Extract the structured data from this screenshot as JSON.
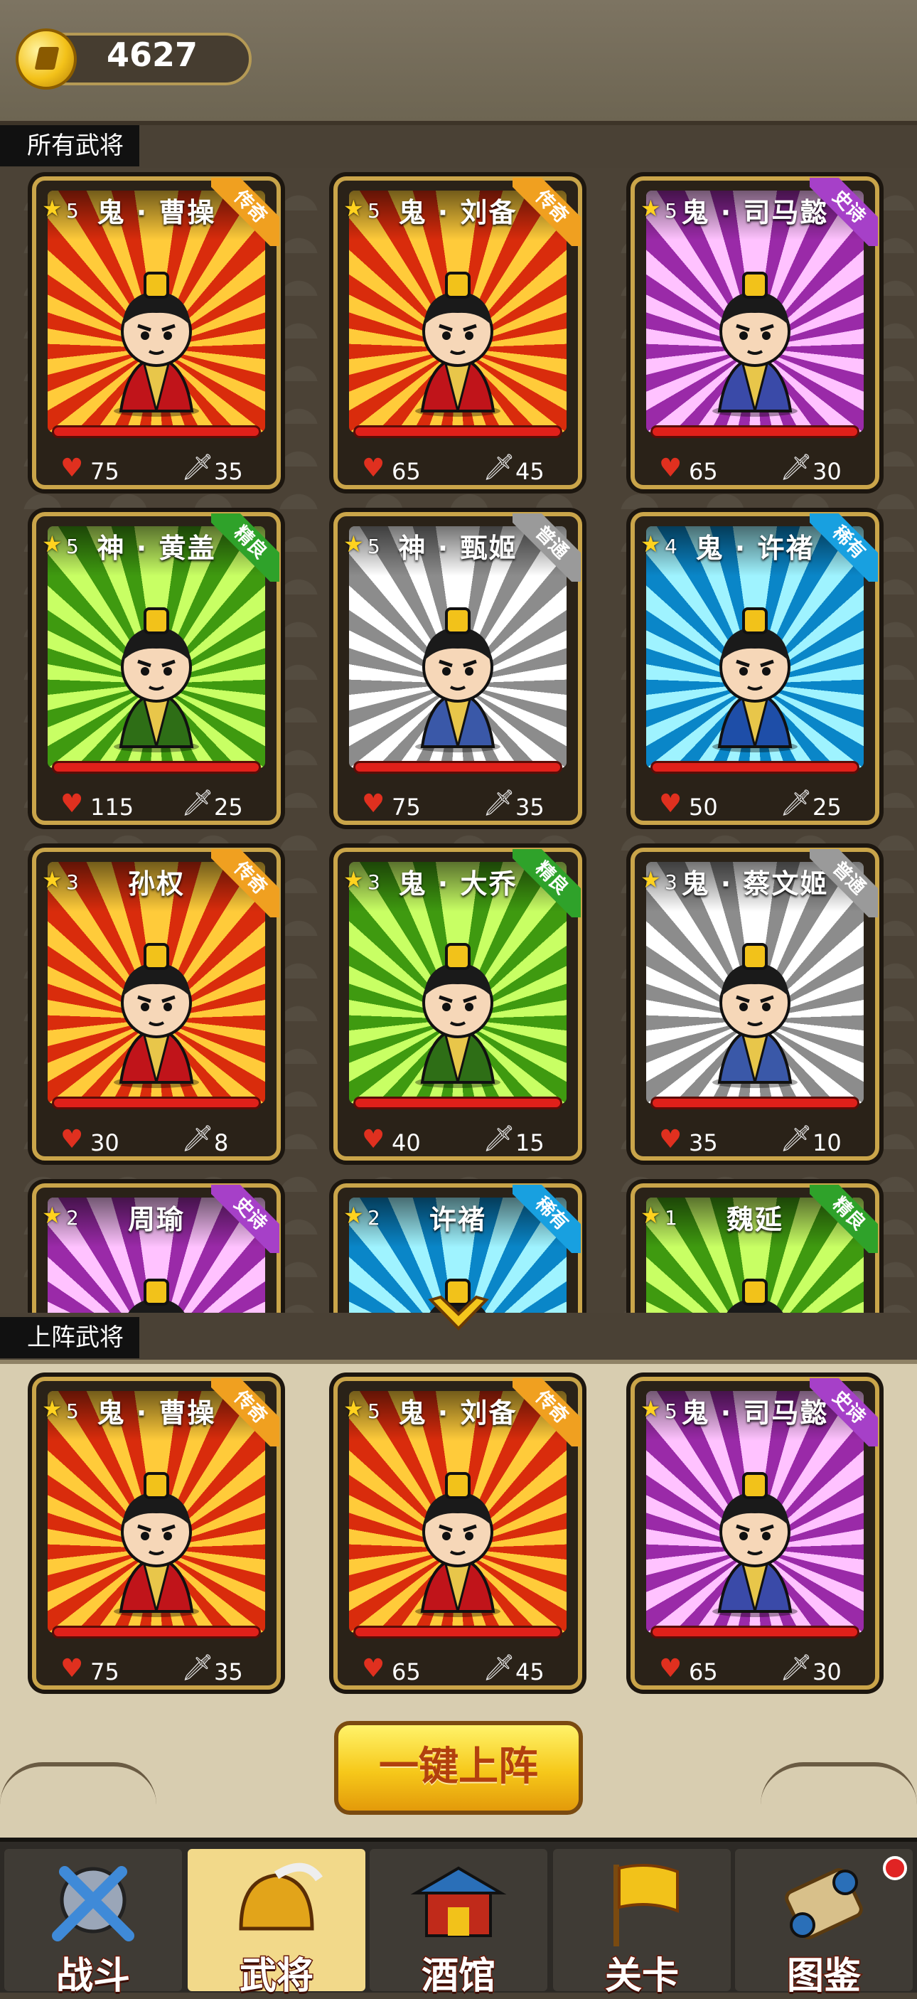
{
  "top": {
    "coins": "4627",
    "coin_icon": "gold-coin-icon"
  },
  "sections": {
    "all": "所有武将",
    "deploy": "上阵武将"
  },
  "ribbon_colors": {
    "传奇": "#f0a020",
    "史诗": "#a640c8",
    "精良": "#2fa22a",
    "普通": "#9a9a9a",
    "稀有": "#18a0e0"
  },
  "roster": [
    {
      "name": "鬼 · 曹操",
      "stars": "5",
      "rarity": "传奇",
      "bg": "red",
      "hp": "75",
      "atk": "35"
    },
    {
      "name": "鬼 · 刘备",
      "stars": "5",
      "rarity": "传奇",
      "bg": "red",
      "hp": "65",
      "atk": "45"
    },
    {
      "name": "鬼 · 司马懿",
      "stars": "5",
      "rarity": "史诗",
      "bg": "purple",
      "hp": "65",
      "atk": "30"
    },
    {
      "name": "神 · 黄盖",
      "stars": "5",
      "rarity": "精良",
      "bg": "green",
      "hp": "115",
      "atk": "25"
    },
    {
      "name": "神 · 甄姬",
      "stars": "5",
      "rarity": "普通",
      "bg": "grey",
      "hp": "75",
      "atk": "35"
    },
    {
      "name": "鬼 · 许褚",
      "stars": "4",
      "rarity": "稀有",
      "bg": "blue",
      "hp": "50",
      "atk": "25"
    },
    {
      "name": "孙权",
      "stars": "3",
      "rarity": "传奇",
      "bg": "red",
      "hp": "30",
      "atk": "8"
    },
    {
      "name": "鬼 · 大乔",
      "stars": "3",
      "rarity": "精良",
      "bg": "green",
      "hp": "40",
      "atk": "15"
    },
    {
      "name": "鬼 · 蔡文姬",
      "stars": "3",
      "rarity": "普通",
      "bg": "grey",
      "hp": "35",
      "atk": "10"
    },
    {
      "name": "周瑜",
      "stars": "2",
      "rarity": "史诗",
      "bg": "purple",
      "hp": "",
      "atk": ""
    },
    {
      "name": "许褚",
      "stars": "2",
      "rarity": "稀有",
      "bg": "blue",
      "hp": "",
      "atk": ""
    },
    {
      "name": "魏延",
      "stars": "1",
      "rarity": "精良",
      "bg": "green",
      "hp": "",
      "atk": ""
    }
  ],
  "deployed": [
    {
      "name": "鬼 · 曹操",
      "stars": "5",
      "rarity": "传奇",
      "bg": "red",
      "hp": "75",
      "atk": "35"
    },
    {
      "name": "鬼 · 刘备",
      "stars": "5",
      "rarity": "传奇",
      "bg": "red",
      "hp": "65",
      "atk": "45"
    },
    {
      "name": "鬼 · 司马懿",
      "stars": "5",
      "rarity": "史诗",
      "bg": "purple",
      "hp": "65",
      "atk": "30"
    }
  ],
  "deploy_button": "一键上阵",
  "nav": [
    {
      "label": "战斗",
      "icon": "crossed-swords-shield-icon",
      "active": false
    },
    {
      "label": "武将",
      "icon": "general-helmet-icon",
      "active": true
    },
    {
      "label": "酒馆",
      "icon": "tavern-pagoda-icon",
      "active": false
    },
    {
      "label": "关卡",
      "icon": "level-flag-icon",
      "active": false
    },
    {
      "label": "图鉴",
      "icon": "scroll-codex-icon",
      "active": false,
      "badge": true
    }
  ]
}
